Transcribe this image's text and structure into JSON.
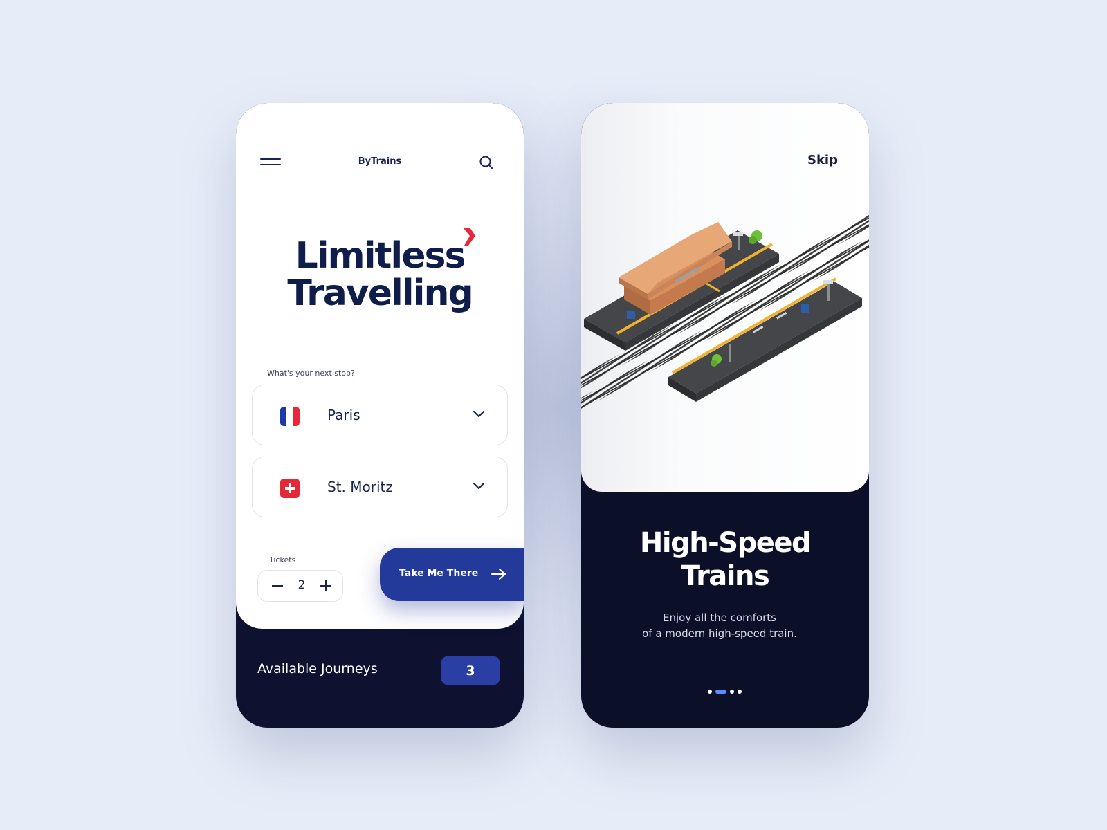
{
  "left_screen": {
    "brand": "ByTrains",
    "hero_line1": "Limitless",
    "hero_line2": "Travelling",
    "prompt": "What's your next stop?",
    "origin": {
      "city": "Paris",
      "flag": "france-flag-icon"
    },
    "destination": {
      "city": "St. Moritz",
      "flag": "switzerland-flag-icon"
    },
    "tickets_label": "Tickets",
    "tickets_count": "2",
    "cta_label": "Take Me There",
    "journeys_label": "Available Journeys",
    "journeys_count": "3"
  },
  "right_screen": {
    "skip_label": "Skip",
    "title_line1": "High-Speed",
    "title_line2": "Trains",
    "subtitle_line1": "Enjoy all the comforts",
    "subtitle_line2": "of a modern high-speed train.",
    "page_indicator": {
      "pages": 4,
      "active": 2
    }
  },
  "colors": {
    "background": "#e7edf8",
    "navy": "#0e1230",
    "primary_blue": "#233a9a",
    "accent_red": "#e8283a",
    "heading": "#0f1d4a"
  }
}
